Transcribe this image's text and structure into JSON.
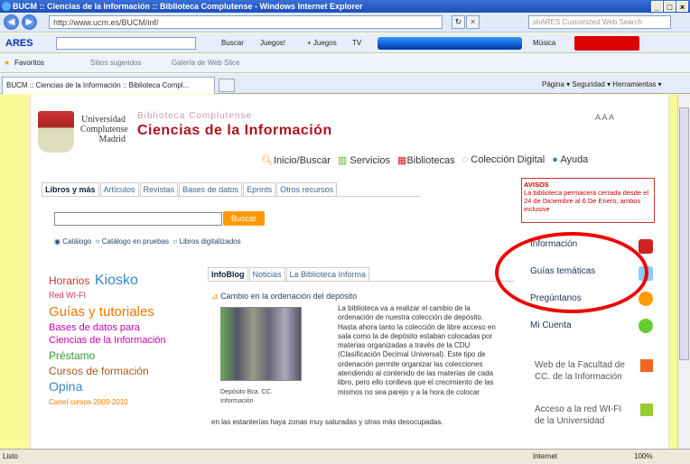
{
  "window": {
    "title": "BUCM :: Ciencias de la Información :: Biblioteca Complutense - Windows Internet Explorer"
  },
  "address": {
    "url": "http://www.ucm.es/BUCM/inf/",
    "search_placeholder": "shARES Customized Web Search"
  },
  "ares": {
    "logo": "ARES",
    "buscar": "Buscar",
    "juegos": "Juegos!",
    "mas_juegos": "+ Juegos",
    "tv": "TV",
    "musica": "Música"
  },
  "favorites": {
    "label": "Favoritos",
    "suggested": "Sitios sugeridos",
    "gallery": "Galería de Web Slice"
  },
  "tab": {
    "label": "BUCM :: Ciencias de la Información :: Biblioteca Compl...",
    "tools": "Página ▾  Seguridad ▾  Herramientas ▾"
  },
  "header": {
    "uni_line1": "Universidad",
    "uni_line2": "Complutense",
    "uni_line3": "Madrid",
    "bib": "Biblioteca Complutense",
    "title": "Ciencias de la Información",
    "font_sizes": "A A A"
  },
  "menu": [
    "Inicio/Buscar",
    "Servicios",
    "Bibliotecas",
    "Colección Digital",
    "Ayuda"
  ],
  "search_tabs": [
    "Libros y más",
    "Artículos",
    "Revistas",
    "Bases de datos",
    "Eprints",
    "Otros recursos"
  ],
  "search": {
    "button": "Buscar",
    "radio1": "Catálogo",
    "radio2": "Catálogo en pruebas",
    "radio3": "Libros digitalizados"
  },
  "left": {
    "horarios": "Horarios",
    "kiosko": "Kiosko",
    "wifi": "Red WI-FI",
    "guias": "Guías y tutoriales",
    "bases": "Bases de datos para",
    "ciencias": "Ciencias de la Información",
    "prestamo": "Préstamo",
    "cursos": "Cursos de formación",
    "opina": "Opina",
    "cartel": "Cartel cursos 2009-2010"
  },
  "blog_tabs": [
    "InfoBlog",
    "Noticias",
    "La Biblioteca Informa"
  ],
  "post": {
    "title": "Cambio en la ordenación del depósito",
    "caption": "Depósito Bca. CC. Información",
    "text": "La biblioteca va a realizar el cambio de la ordenación de nuestra colección de depósito. Hasta ahora tanto la colección de libre acceso en sala como la de depósito estaban colocadas por materias organizadas a través de la CDU (Clasificación Decimal Universal). Este tipo de ordenación permite organizar las colecciones atendiendo al contenido de las materias de cada libro, pero ello conlleva que el crecimiento de las mismos no sea parejo y a la hora de colocar",
    "foot": "en las estanterías haya zonas muy saturadas y otras más desocupadas."
  },
  "right": {
    "avisos": "AVISOS",
    "avisos_text": "La biblioteca permacerá cerrada desde el 24 de Diciembre al 6 De Enero, ambos inclusive",
    "informacion": "Información",
    "guias": "Guías temáticas",
    "preguntanos": "Pregúntanos",
    "cuenta": "Mi Cuenta",
    "web": "Web de la Facultad de CC. de la Información",
    "acceso": "Acceso a la red WI-FI de la Universidad"
  },
  "status": {
    "left": "Listo",
    "zone": "Internet",
    "zoom": "100%"
  },
  "colors": {
    "accent": "#b01020",
    "link": "#235",
    "highlight": "#e00"
  }
}
